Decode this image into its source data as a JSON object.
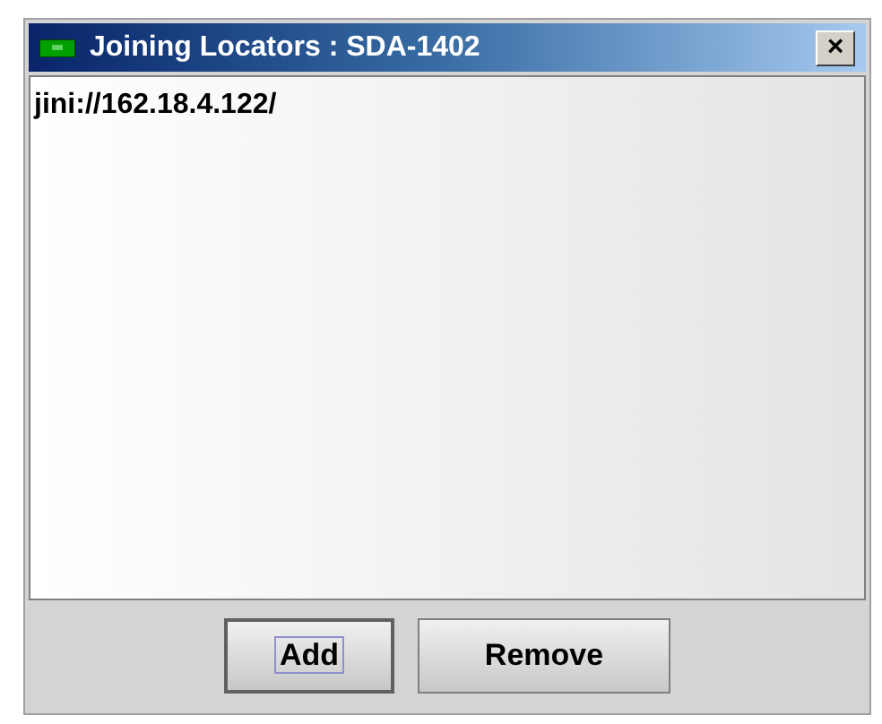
{
  "window": {
    "title": "Joining Locators : SDA-1402",
    "close": "×"
  },
  "list": {
    "items": [
      {
        "label": "jini://162.18.4.122/",
        "selected": false
      }
    ]
  },
  "buttons": [
    {
      "label": "Add",
      "focused": true
    },
    {
      "label": "Remove",
      "focused": false
    }
  ]
}
